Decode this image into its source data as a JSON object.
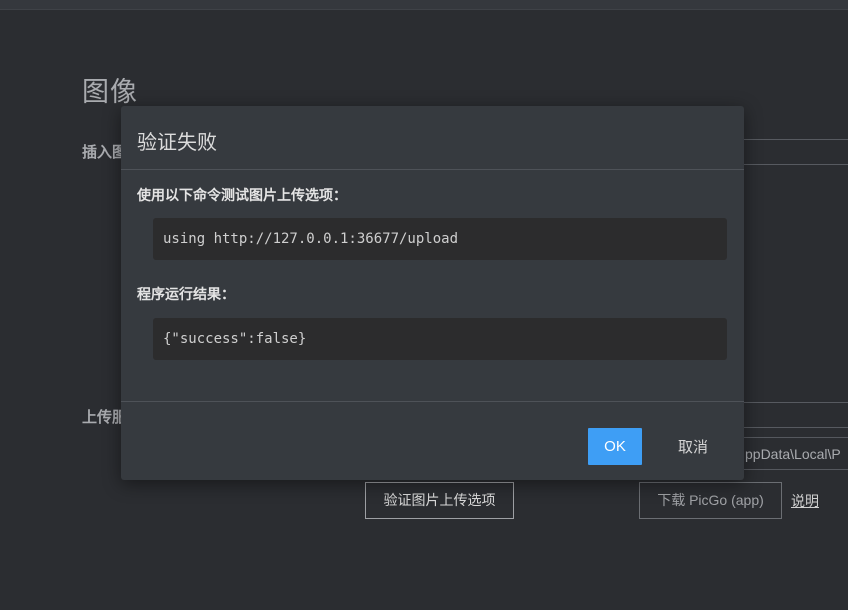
{
  "page": {
    "title": "图像",
    "insert_label": "插入图",
    "upload_label": "上传服",
    "path_value": "ppData\\Local\\P",
    "verify_button": "验证图片上传选项",
    "download_button": "下载 PicGo (app)",
    "help_link": "说明"
  },
  "dialog": {
    "title": "验证失败",
    "command_label": "使用以下命令测试图片上传选项：",
    "command": "using http://127.0.0.1:36677/upload",
    "result_label": "程序运行结果：",
    "result": "{\"success\":false}",
    "ok_label": "OK",
    "cancel_label": "取消"
  },
  "colors": {
    "background": "#2b2d31",
    "dialog": "#363a3f",
    "accent": "#3e9ef5"
  }
}
